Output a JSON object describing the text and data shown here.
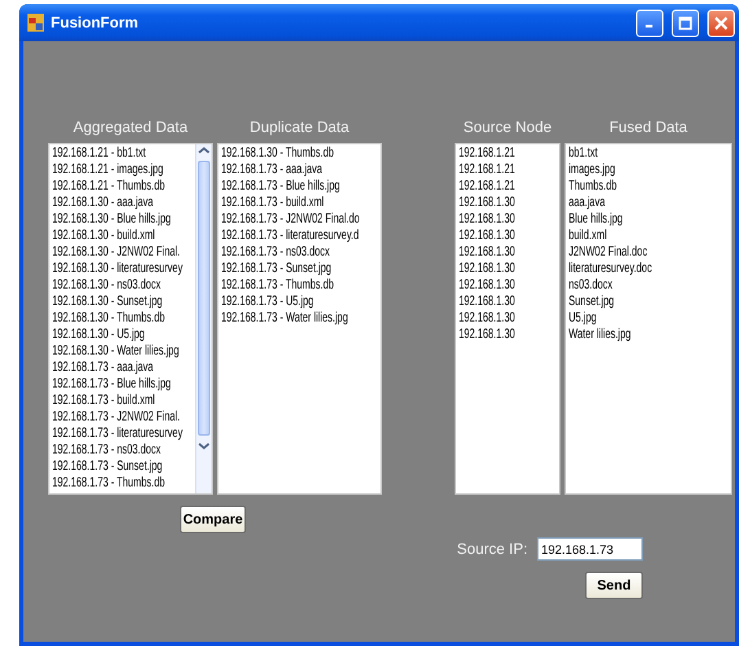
{
  "window": {
    "title": "FusionForm"
  },
  "panels": [
    {
      "label": "Aggregated Data",
      "scrollbar": true,
      "items": [
        "192.168.1.21 - bb1.txt",
        "192.168.1.21 - images.jpg",
        "192.168.1.21 - Thumbs.db",
        "192.168.1.30 - aaa.java",
        "192.168.1.30 - Blue hills.jpg",
        "192.168.1.30 - build.xml",
        "192.168.1.30 - J2NW02 Final.",
        "192.168.1.30 - literaturesurvey",
        "192.168.1.30 - ns03.docx",
        "192.168.1.30 - Sunset.jpg",
        "192.168.1.30 - Thumbs.db",
        "192.168.1.30 - U5.jpg",
        "192.168.1.30 - Water lilies.jpg",
        "192.168.1.73 - aaa.java",
        "192.168.1.73 - Blue hills.jpg",
        "192.168.1.73 - build.xml",
        "192.168.1.73 - J2NW02 Final.",
        "192.168.1.73 - literaturesurvey",
        "192.168.1.73 - ns03.docx",
        "192.168.1.73 - Sunset.jpg",
        "192.168.1.73 - Thumbs.db"
      ]
    },
    {
      "label": "Duplicate Data",
      "scrollbar": false,
      "items": [
        "192.168.1.30 - Thumbs.db",
        "192.168.1.73 - aaa.java",
        "192.168.1.73 - Blue hills.jpg",
        "192.168.1.73 - build.xml",
        "192.168.1.73 - J2NW02 Final.do",
        "192.168.1.73 - literaturesurvey.d",
        "192.168.1.73 - ns03.docx",
        "192.168.1.73 - Sunset.jpg",
        "192.168.1.73 - Thumbs.db",
        "192.168.1.73 - U5.jpg",
        "192.168.1.73 - Water lilies.jpg"
      ]
    },
    {
      "label": "Source Node",
      "scrollbar": false,
      "items": [
        "192.168.1.21",
        "192.168.1.21",
        "192.168.1.21",
        "192.168.1.30",
        "192.168.1.30",
        "192.168.1.30",
        "192.168.1.30",
        "192.168.1.30",
        "192.168.1.30",
        "192.168.1.30",
        "192.168.1.30",
        "192.168.1.30"
      ]
    },
    {
      "label": "Fused Data",
      "scrollbar": false,
      "items": [
        "bb1.txt",
        "images.jpg",
        "Thumbs.db",
        "aaa.java",
        "Blue hills.jpg",
        "build.xml",
        "J2NW02 Final.doc",
        "literaturesurvey.doc",
        "ns03.docx",
        "Sunset.jpg",
        "U5.jpg",
        "Water lilies.jpg"
      ]
    }
  ],
  "compare_button": "Compare",
  "source_ip": {
    "label": "Source IP:",
    "value": "192.168.1.73"
  },
  "send_button": "Send"
}
